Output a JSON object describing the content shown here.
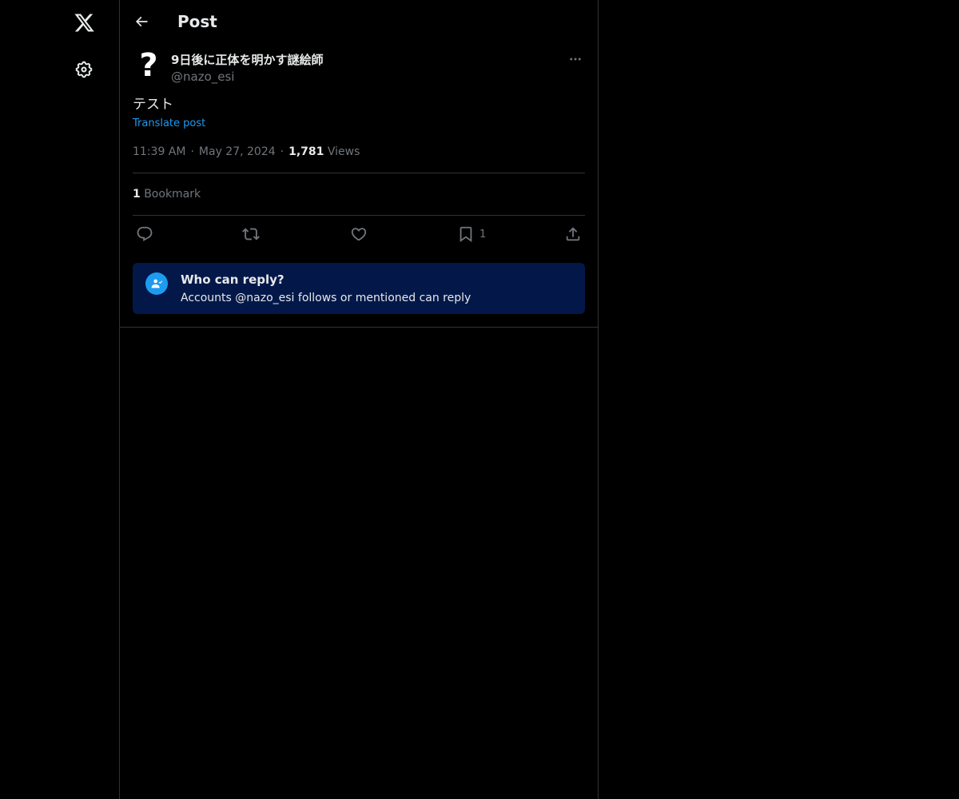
{
  "header": {
    "title": "Post"
  },
  "post": {
    "author_name": "9日後に正体を明かす謎絵師",
    "author_handle": "@nazo_esi",
    "avatar_glyph": "?",
    "text": "テスト",
    "translate_label": "Translate post",
    "time": "11:39 AM",
    "date": "May 27, 2024",
    "views_count": "1,781",
    "views_label": "Views",
    "bookmark_count": "1",
    "bookmark_label": "Bookmark"
  },
  "actions": {
    "bookmark_count": "1"
  },
  "reply_restriction": {
    "title": "Who can reply?",
    "subtitle": "Accounts @nazo_esi follows or mentioned can reply"
  },
  "icons": {
    "nav": [
      "x-logo-icon",
      "settings-icon"
    ],
    "actions": [
      "reply-icon",
      "repost-icon",
      "like-icon",
      "bookmark-icon",
      "share-icon"
    ]
  },
  "colors": {
    "background": "#000000",
    "accent": "#1d9bf0",
    "reply_box": "#031849",
    "muted": "#71767b",
    "border": "#2f3336"
  }
}
